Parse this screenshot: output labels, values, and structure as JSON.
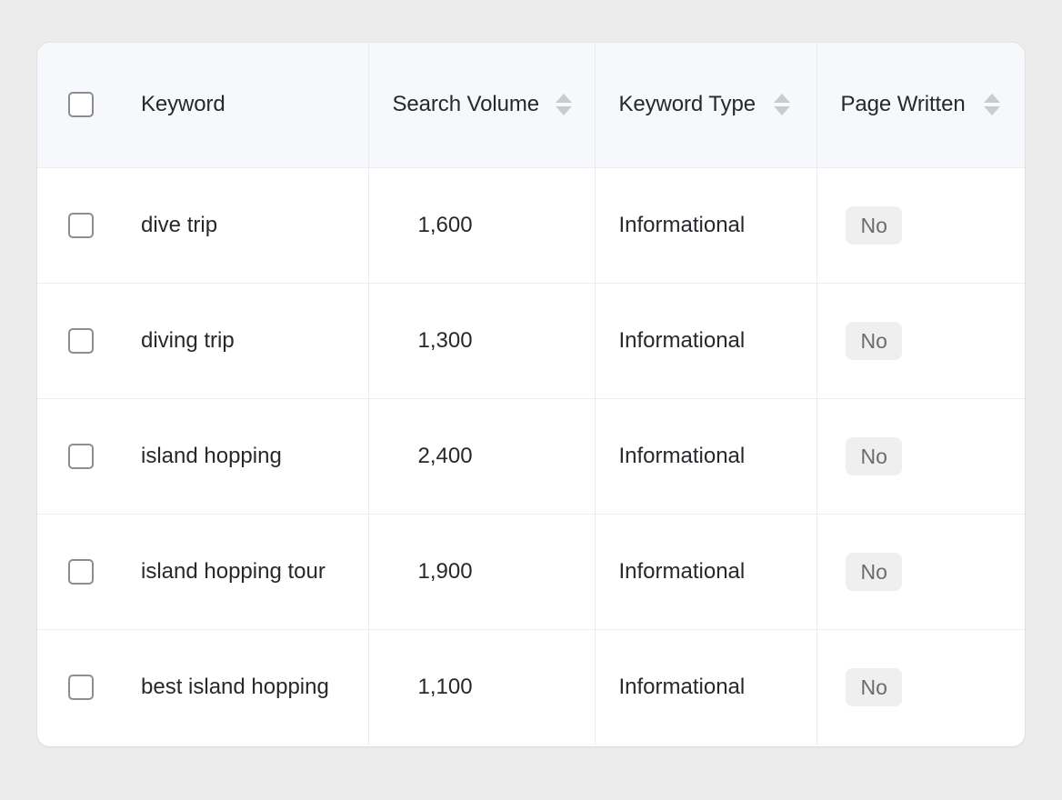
{
  "table": {
    "columns": {
      "keyword": "Keyword",
      "search_volume": "Search Volume",
      "keyword_type": "Keyword Type",
      "page_written": "Page Written"
    },
    "rows": [
      {
        "keyword": "dive trip",
        "search_volume": "1,600",
        "keyword_type": "Informational",
        "page_written": "No"
      },
      {
        "keyword": "diving trip",
        "search_volume": "1,300",
        "keyword_type": "Informational",
        "page_written": "No"
      },
      {
        "keyword": "island hopping",
        "search_volume": "2,400",
        "keyword_type": "Informational",
        "page_written": "No"
      },
      {
        "keyword": "island hopping tour",
        "search_volume": "1,900",
        "keyword_type": "Informational",
        "page_written": "No"
      },
      {
        "keyword": "best island hopping",
        "search_volume": "1,100",
        "keyword_type": "Informational",
        "page_written": "No"
      }
    ]
  },
  "icons": {
    "sort": "sort-icon",
    "checkbox": "checkbox"
  },
  "colors": {
    "header_background": "#f6f8fc",
    "page_background": "#ececec",
    "badge_background": "#efefef"
  }
}
